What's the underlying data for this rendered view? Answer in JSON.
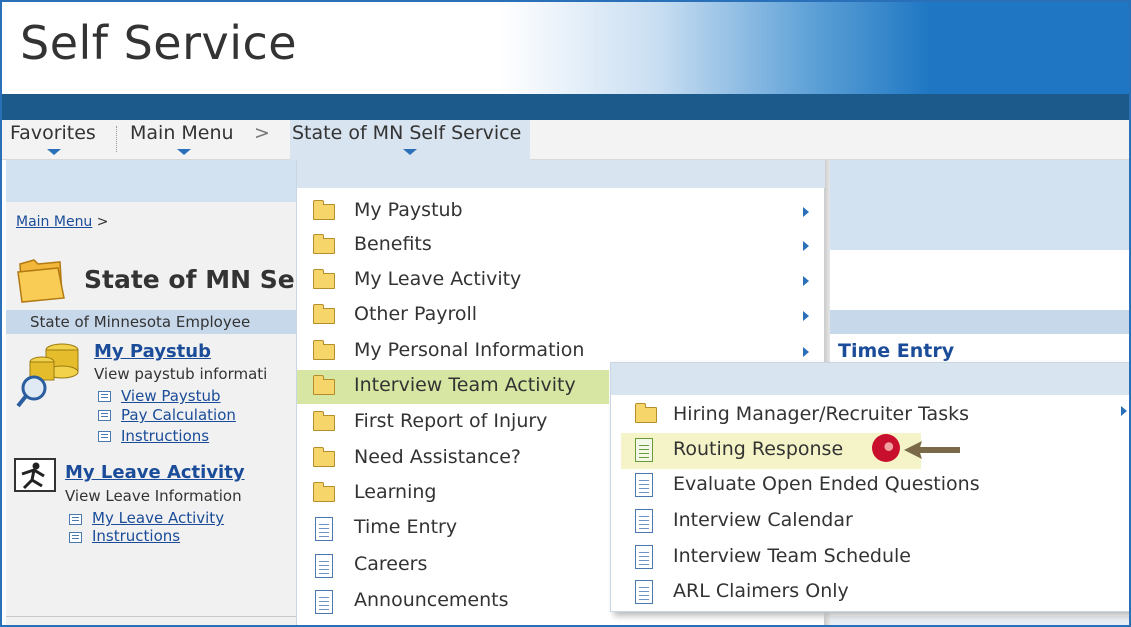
{
  "banner": {
    "title": "Self Service"
  },
  "menubar": {
    "favorites": "Favorites",
    "main_menu": "Main Menu",
    "separator": ">",
    "current": "State of MN Self Service"
  },
  "breadcrumb": {
    "link": "Main Menu",
    "separator": ">"
  },
  "page": {
    "heading": "State of MN Se",
    "employee_label": "State of Minnesota Employee"
  },
  "tiles": {
    "paystub": {
      "title": "My Paystub",
      "desc": "View paystub informati",
      "links": [
        "View Paystub",
        "Pay Calculation",
        "Instructions"
      ]
    },
    "leave": {
      "title": "My Leave Activity",
      "desc": "View Leave Information",
      "links": [
        "My Leave Activity",
        "Instructions"
      ]
    },
    "time_entry": "Time Entry"
  },
  "menu1": {
    "items": [
      {
        "label": "My Paystub",
        "icon": "folder",
        "submenu": true
      },
      {
        "label": "Benefits",
        "icon": "folder",
        "submenu": true
      },
      {
        "label": "My Leave Activity",
        "icon": "folder",
        "submenu": true
      },
      {
        "label": "Other Payroll",
        "icon": "folder",
        "submenu": true
      },
      {
        "label": "My Personal Information",
        "icon": "folder",
        "submenu": true
      },
      {
        "label": "Interview Team Activity",
        "icon": "folder",
        "submenu": true,
        "active": true
      },
      {
        "label": "First Report of Injury",
        "icon": "folder"
      },
      {
        "label": "Need Assistance?",
        "icon": "folder"
      },
      {
        "label": "Learning",
        "icon": "folder"
      },
      {
        "label": "Time Entry",
        "icon": "page"
      },
      {
        "label": "Careers",
        "icon": "page"
      },
      {
        "label": "Announcements",
        "icon": "page"
      }
    ]
  },
  "menu2": {
    "items": [
      {
        "label": "Hiring Manager/Recruiter Tasks",
        "icon": "folder",
        "submenu": true
      },
      {
        "label": "Routing Response",
        "icon": "page",
        "highlighted": true
      },
      {
        "label": "Evaluate Open Ended Questions",
        "icon": "page"
      },
      {
        "label": "Interview Calendar",
        "icon": "page"
      },
      {
        "label": "Interview Team Schedule",
        "icon": "page"
      },
      {
        "label": "ARL Claimers Only",
        "icon": "page"
      }
    ]
  },
  "colors": {
    "link_blue": "#1a4c99",
    "active_row": "#d7e7a3",
    "highlight_row": "#f4f4c8",
    "header_blue": "#1f77c3",
    "dark_bar": "#1d5a8c",
    "annotation_target": "#c8102e",
    "annotation_arrow": "#7a6a4a"
  }
}
